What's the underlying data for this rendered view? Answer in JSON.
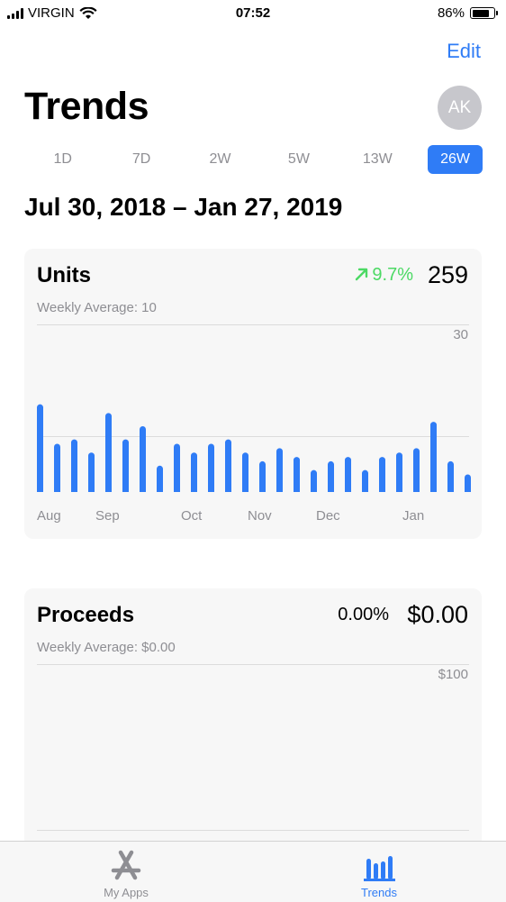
{
  "status_bar": {
    "carrier": "VIRGIN",
    "time": "07:52",
    "battery": "86%",
    "battery_level": 0.86
  },
  "header": {
    "edit_label": "Edit",
    "title": "Trends",
    "avatar_initials": "AK"
  },
  "periods": [
    {
      "label": "1D",
      "active": false
    },
    {
      "label": "7D",
      "active": false
    },
    {
      "label": "2W",
      "active": false
    },
    {
      "label": "5W",
      "active": false
    },
    {
      "label": "13W",
      "active": false
    },
    {
      "label": "26W",
      "active": true
    }
  ],
  "date_range": "Jul 30, 2018 – Jan 27, 2019",
  "units_card": {
    "title": "Units",
    "change": "9.7%",
    "total": "259",
    "subtitle": "Weekly Average: 10",
    "axis_max_label": "30"
  },
  "proceeds_card": {
    "title": "Proceeds",
    "change": "0.00%",
    "total": "$0.00",
    "subtitle": "Weekly Average: $0.00",
    "axis_max_label": "$100"
  },
  "chart_data": {
    "type": "bar",
    "ylim": [
      0,
      30
    ],
    "grid": true,
    "bar_color": "#2f7cf6",
    "values": [
      20,
      11,
      12,
      9,
      18,
      12,
      15,
      6,
      11,
      9,
      11,
      12,
      9,
      7,
      10,
      8,
      5,
      7,
      8,
      5,
      8,
      9,
      10,
      16,
      7,
      4
    ],
    "x_tick_labels": [
      "Aug",
      "Sep",
      "Oct",
      "Nov",
      "Dec",
      "Jan"
    ],
    "x_tick_positions": [
      0,
      4,
      9,
      13,
      17,
      22
    ]
  },
  "tabs": [
    {
      "label": "My Apps",
      "icon": "app-store-icon",
      "active": false
    },
    {
      "label": "Trends",
      "icon": "trends-bars-icon",
      "active": true
    }
  ],
  "colors": {
    "accent": "#2f7cf6",
    "positive": "#4cd964",
    "muted": "#8e8e93",
    "card_bg": "#f7f7f7"
  }
}
